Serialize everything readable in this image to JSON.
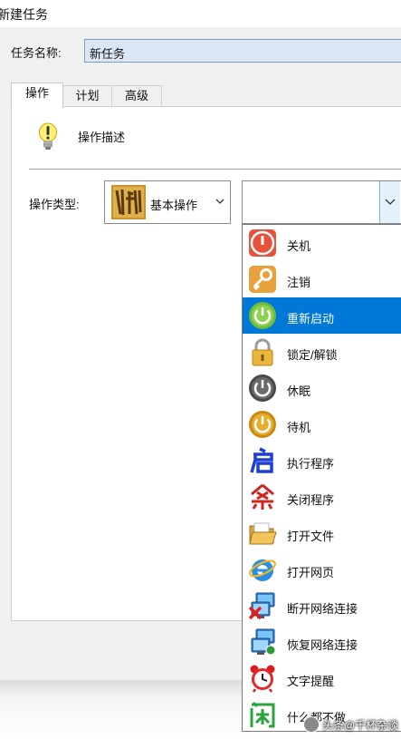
{
  "window": {
    "title": "新建任务"
  },
  "form": {
    "name_label": "任务名称:",
    "name_value": "新任务"
  },
  "tabs": [
    {
      "label": "操作"
    },
    {
      "label": "计划"
    },
    {
      "label": "高级"
    }
  ],
  "action": {
    "description": "操作描述",
    "type_label": "操作类型:",
    "category_value": "基本操作"
  },
  "dropdown": {
    "items": [
      {
        "label": "关机",
        "icon": "power-red-icon"
      },
      {
        "label": "注销",
        "icon": "key-icon"
      },
      {
        "label": "重新启动",
        "icon": "power-green-icon",
        "selected": true
      },
      {
        "label": "锁定/解锁",
        "icon": "padlock-icon"
      },
      {
        "label": "休眠",
        "icon": "power-gray-icon"
      },
      {
        "label": "待机",
        "icon": "power-orange-icon"
      },
      {
        "label": "执行程序",
        "icon": "qi-glyph-icon"
      },
      {
        "label": "关闭程序",
        "icon": "sha-glyph-icon"
      },
      {
        "label": "打开文件",
        "icon": "folder-icon"
      },
      {
        "label": "打开网页",
        "icon": "ie-icon"
      },
      {
        "label": "断开网络连接",
        "icon": "network-disconnect-icon"
      },
      {
        "label": "恢复网络连接",
        "icon": "network-connect-icon"
      },
      {
        "label": "文字提醒",
        "icon": "alarm-clock-icon"
      },
      {
        "label": "什么都不做",
        "icon": "xian-glyph-icon"
      }
    ]
  },
  "watermark": "头条@千杯杂谈",
  "colors": {
    "selection": "#0078d7",
    "input_bg": "#dbe7f5"
  }
}
